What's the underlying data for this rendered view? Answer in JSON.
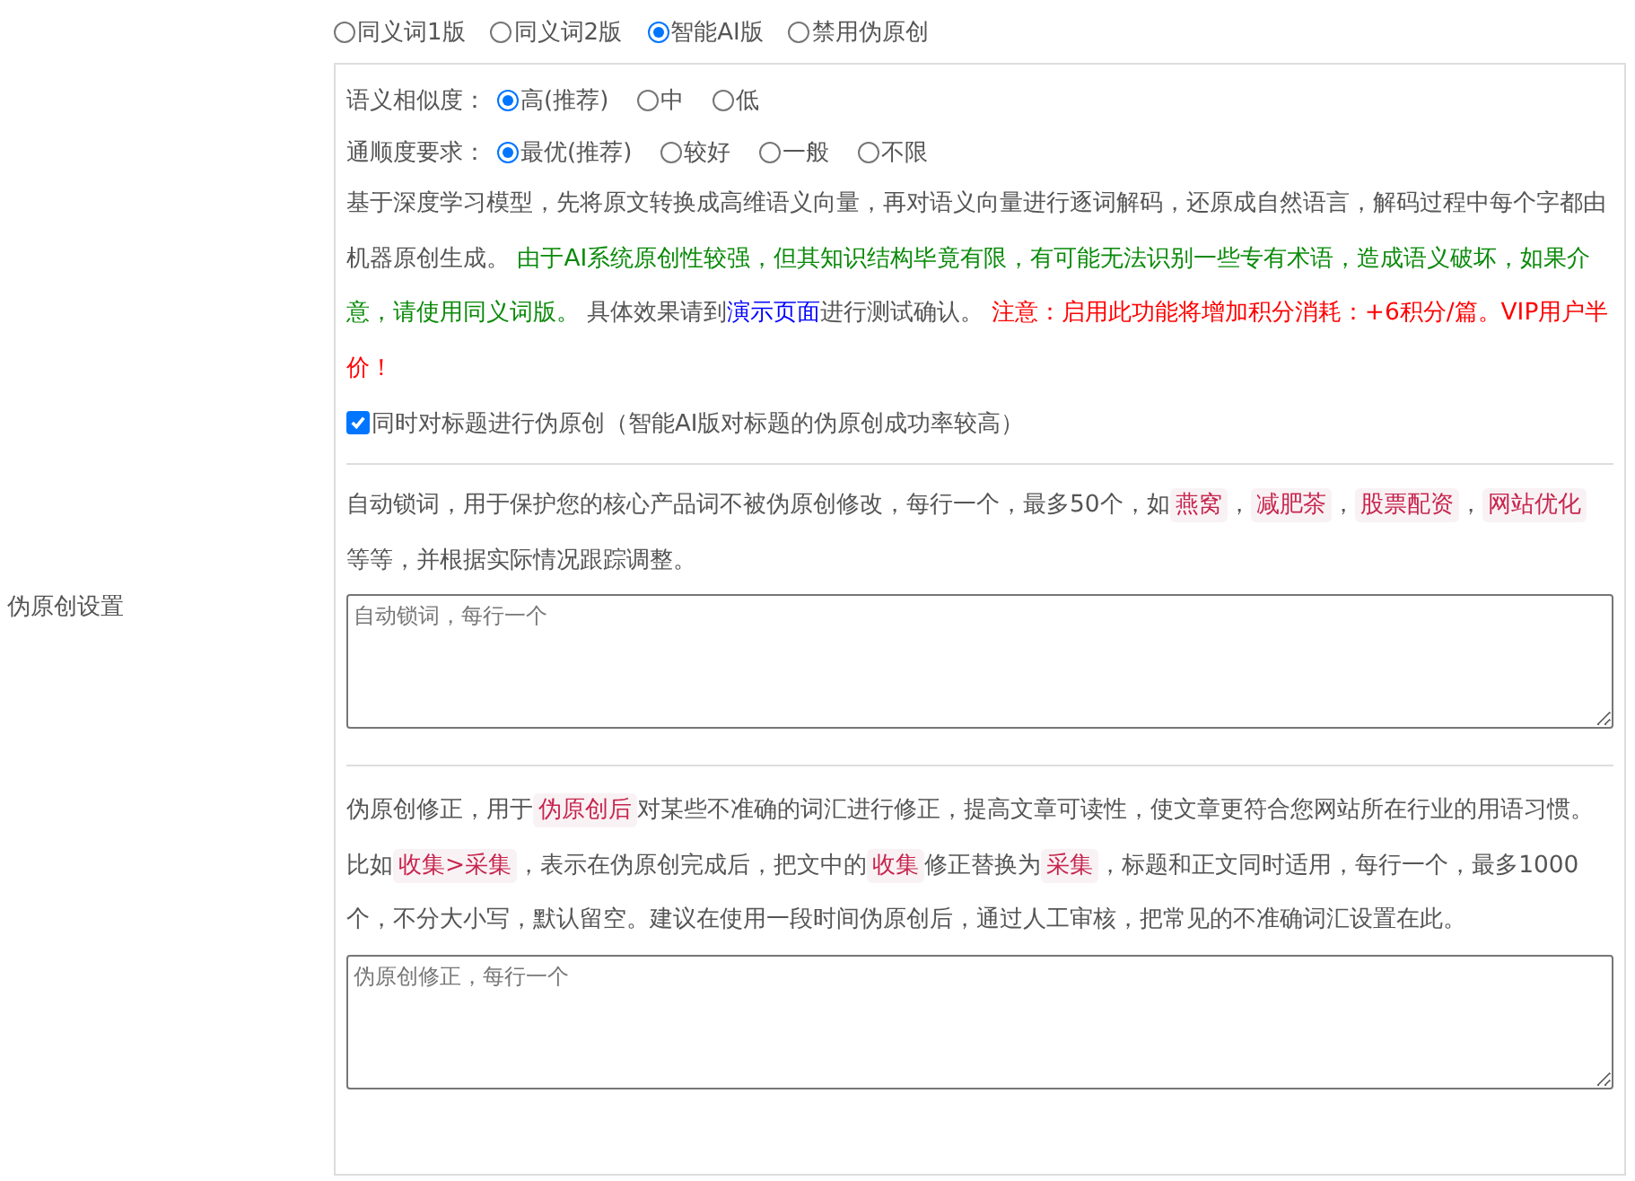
{
  "sidebar_label": "伪原创设置",
  "mode_options": [
    {
      "label": "同义词1版",
      "selected": false
    },
    {
      "label": "同义词2版",
      "selected": false
    },
    {
      "label": "智能AI版",
      "selected": true
    },
    {
      "label": "禁用伪原创",
      "selected": false
    }
  ],
  "similarity": {
    "label": "语义相似度：",
    "options": [
      {
        "label": "高(推荐)",
        "selected": true
      },
      {
        "label": "中",
        "selected": false
      },
      {
        "label": "低",
        "selected": false
      }
    ]
  },
  "fluency": {
    "label": "通顺度要求：",
    "options": [
      {
        "label": "最优(推荐)",
        "selected": true
      },
      {
        "label": "较好",
        "selected": false
      },
      {
        "label": "一般",
        "selected": false
      },
      {
        "label": "不限",
        "selected": false
      }
    ]
  },
  "ai_description": [
    {
      "kind": "plain",
      "text": "基于深度学习模型，先将原文转换成高维语义向量，再对语义向量进行逐词解码，还原成自然语言，解码过程中每个字都由机器原创生成。 "
    },
    {
      "kind": "green",
      "text": "由于AI系统原创性较强，但其知识结构毕竟有限，有可能无法识别一些专有术语，造成语义破坏，如果介意，请使用同义词版。"
    },
    {
      "kind": "plain",
      "text": " 具体效果请到"
    },
    {
      "kind": "link",
      "text": "演示页面"
    },
    {
      "kind": "plain",
      "text": "进行测试确认。 "
    },
    {
      "kind": "red",
      "text": "注意：启用此功能将增加积分消耗：+6积分/篇。VIP用户半价！"
    }
  ],
  "title_option": {
    "label": "同时对标题进行伪原创（智能AI版对标题的伪原创成功率较高）",
    "checked": true
  },
  "lock_words": {
    "description": [
      {
        "kind": "plain",
        "text": "自动锁词，用于保护您的核心产品词不被伪原创修改，每行一个，最多50个，如"
      },
      {
        "kind": "tag",
        "text": "燕窝"
      },
      {
        "kind": "plain",
        "text": "，"
      },
      {
        "kind": "tag",
        "text": "减肥茶"
      },
      {
        "kind": "plain",
        "text": "，"
      },
      {
        "kind": "tag",
        "text": "股票配资"
      },
      {
        "kind": "plain",
        "text": "，"
      },
      {
        "kind": "tag",
        "text": "网站优化"
      },
      {
        "kind": "plain",
        "text": " 等等，并根据实际情况跟踪调整。"
      }
    ],
    "placeholder": "自动锁词，每行一个"
  },
  "corrections": {
    "description": [
      {
        "kind": "plain",
        "text": "伪原创修正，用于"
      },
      {
        "kind": "tag",
        "text": "伪原创后"
      },
      {
        "kind": "plain",
        "text": "对某些不准确的词汇进行修正，提高文章可读性，使文章更符合您网站所在行业的用语习惯。比如"
      },
      {
        "kind": "tag",
        "text": "收集>采集"
      },
      {
        "kind": "plain",
        "text": "，表示在伪原创完成后，把文中的"
      },
      {
        "kind": "tag",
        "text": "收集"
      },
      {
        "kind": "plain",
        "text": "修正替换为"
      },
      {
        "kind": "tag",
        "text": "采集"
      },
      {
        "kind": "plain",
        "text": "，标题和正文同时适用，每行一个，最多1000个，不分大小写，默认留空。建议在使用一段时间伪原创后，通过人工审核，把常见的不准确词汇设置在此。"
      }
    ],
    "placeholder": "伪原创修正，每行一个"
  }
}
